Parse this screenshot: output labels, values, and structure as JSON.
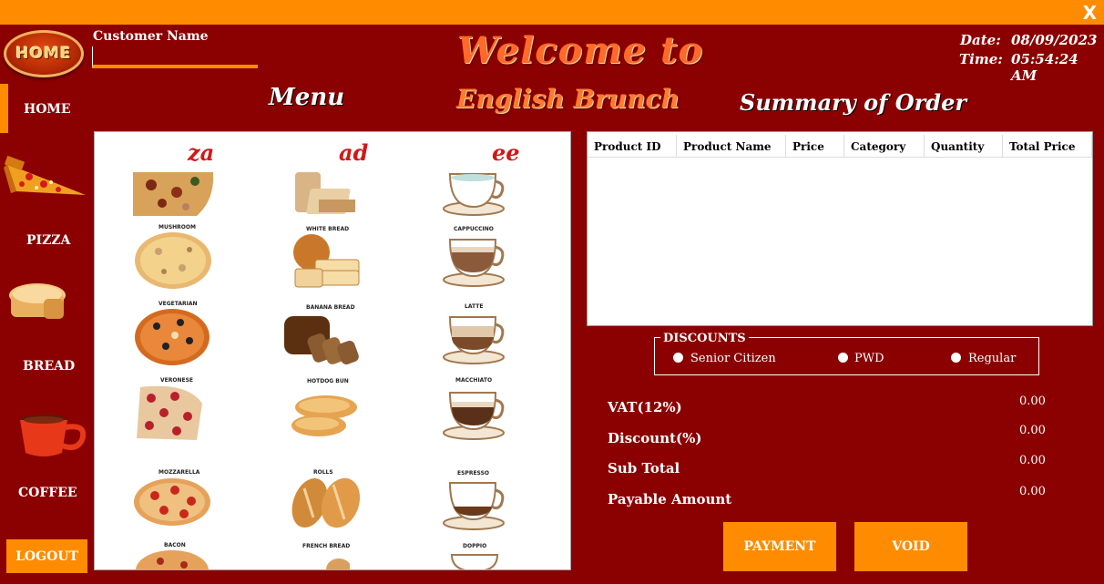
{
  "window": {
    "close_label": "X"
  },
  "header": {
    "logo_text": "HOME",
    "customer_label": "Customer Name",
    "customer_value": "",
    "welcome": "Welcome to",
    "brand": "English Brunch",
    "menu_title": "Menu",
    "summary_title": "Summary of Order",
    "date_label": "Date:",
    "date_value": "08/09/2023",
    "time_label": "Time:",
    "time_value": "05:54:24 AM"
  },
  "sidebar": {
    "items": [
      {
        "label": "HOME"
      },
      {
        "label": "PIZZA",
        "icon": "pizza-icon"
      },
      {
        "label": "BREAD",
        "icon": "bread-icon"
      },
      {
        "label": "COFFEE",
        "icon": "coffee-icon"
      }
    ],
    "logout_label": "LOGOUT"
  },
  "menu": {
    "column_heads": [
      "za",
      "ad",
      "ee"
    ],
    "pizza": [
      "MUSHROOM",
      "VEGETARIAN",
      "VERONESE",
      "MOZZARELLA",
      "BACON"
    ],
    "bread": [
      "WHITE BREAD",
      "BANANA BREAD",
      "HOTDOG BUN",
      "ROLLS",
      "FRENCH BREAD"
    ],
    "coffee": [
      "CAPPUCCINO",
      "LATTE",
      "MACCHIATO",
      "ESPRESSO",
      "DOPPIO"
    ]
  },
  "order_table": {
    "columns": [
      "Product ID",
      "Product Name",
      "Price",
      "Category",
      "Quantity",
      "Total Price"
    ],
    "rows": []
  },
  "discounts": {
    "title": "DISCOUNTS",
    "options": [
      "Senior Citizen",
      "PWD",
      "Regular"
    ]
  },
  "summary": {
    "vat_label": "VAT(12%)",
    "vat_value": "0.00",
    "discount_label": "Discount(%)",
    "discount_value": "0.00",
    "subtotal_label": "Sub Total",
    "subtotal_value": "0.00",
    "payable_label": "Payable Amount",
    "payable_value": "0.00"
  },
  "actions": {
    "payment_label": "PAYMENT",
    "void_label": "VOID"
  },
  "colors": {
    "background": "#8b0000",
    "accent": "#ff8c00"
  }
}
